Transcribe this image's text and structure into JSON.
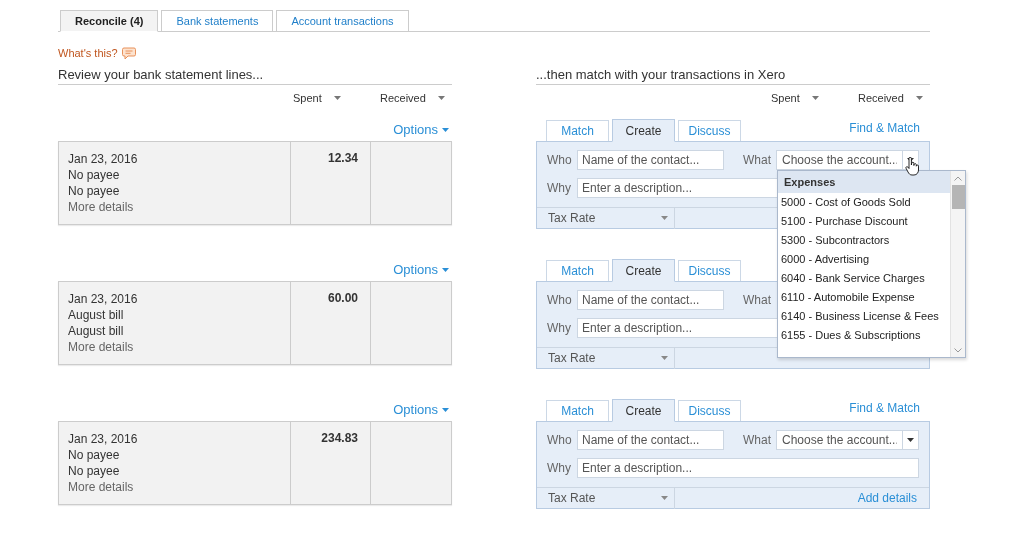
{
  "tabs": [
    {
      "label": "Reconcile (4)",
      "selected": true
    },
    {
      "label": "Bank statements",
      "selected": false
    },
    {
      "label": "Account transactions",
      "selected": false
    }
  ],
  "help_link": "What's this?",
  "statement": {
    "title": "Review your bank statement lines...",
    "columns": [
      "Spent",
      "Received"
    ],
    "lines": [
      {
        "options": "Options",
        "date": "Jan 23, 2016",
        "payee": "No payee",
        "reference": "No payee",
        "details_link": "More details",
        "spent": "12.34"
      },
      {
        "options": "Options",
        "date": "Jan 23, 2016",
        "payee": "August bill",
        "reference": "August bill",
        "details_link": "More details",
        "spent": "60.00"
      },
      {
        "options": "Options",
        "date": "Jan 23, 2016",
        "payee": "No payee",
        "reference": "No payee",
        "details_link": "More details",
        "spent": "234.83"
      }
    ]
  },
  "matching": {
    "title": "...then match with your transactions in Xero",
    "columns": [
      "Spent",
      "Received"
    ],
    "panels": [
      {
        "tabs": [
          {
            "label": "Match",
            "selected": false
          },
          {
            "label": "Create",
            "selected": true
          },
          {
            "label": "Discuss",
            "selected": false
          }
        ],
        "find_match": "Find & Match",
        "who_label": "Who",
        "who_placeholder": "Name of the contact...",
        "what_label": "What",
        "what_placeholder": "Choose the account...",
        "why_label": "Why",
        "why_placeholder": "Enter a description...",
        "tax_rate": "Tax Rate"
      },
      {
        "tabs": [
          {
            "label": "Match",
            "selected": false
          },
          {
            "label": "Create",
            "selected": true
          },
          {
            "label": "Discuss",
            "selected": false
          }
        ],
        "who_label": "Who",
        "who_placeholder": "Name of the contact...",
        "what_label": "What",
        "why_label": "Why",
        "why_placeholder": "Enter a description...",
        "tax_rate": "Tax Rate"
      },
      {
        "tabs": [
          {
            "label": "Match",
            "selected": false
          },
          {
            "label": "Create",
            "selected": true
          },
          {
            "label": "Discuss",
            "selected": false
          }
        ],
        "find_match": "Find & Match",
        "who_label": "Who",
        "who_placeholder": "Name of the contact...",
        "what_label": "What",
        "what_placeholder": "Choose the account...",
        "why_label": "Why",
        "why_placeholder": "Enter a description...",
        "tax_rate": "Tax Rate",
        "add_details": "Add details"
      }
    ]
  },
  "account_dropdown": {
    "group": "Expenses",
    "items": [
      "5000 - Cost of Goods Sold",
      "5100 - Purchase Discount",
      "5300 - Subcontractors",
      "6000 - Advertising",
      "6040 - Bank Service Charges",
      "6110 - Automobile Expense",
      "6140 - Business License & Fees",
      "6155 - Dues & Subscriptions"
    ]
  }
}
